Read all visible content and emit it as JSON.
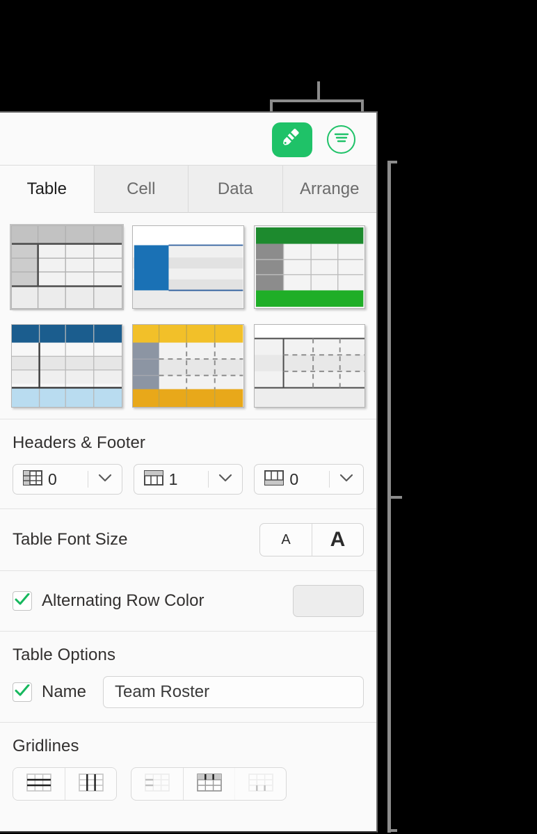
{
  "toolbar": {
    "format_button_label": "Format",
    "format_icon": "paintbrush-icon",
    "menu_button_label": "Format Menu",
    "menu_icon": "list-lines-circle-icon"
  },
  "tabs": [
    {
      "label": "Table",
      "active": true
    },
    {
      "label": "Cell",
      "active": false
    },
    {
      "label": "Data",
      "active": false
    },
    {
      "label": "Arrange",
      "active": false
    }
  ],
  "table_styles": [
    {
      "name": "style-gray-header-column",
      "selected": true
    },
    {
      "name": "style-blue-left-accent",
      "selected": false
    },
    {
      "name": "style-green-header-footer",
      "selected": false
    },
    {
      "name": "style-navy-header-blue-footer",
      "selected": false
    },
    {
      "name": "style-yellow-header-footer",
      "selected": false
    },
    {
      "name": "style-plain-dashed",
      "selected": false
    }
  ],
  "headers_footer": {
    "title": "Headers & Footer",
    "steppers": [
      {
        "icon": "header-columns-icon",
        "value": "0",
        "name": "header-columns-stepper"
      },
      {
        "icon": "header-rows-icon",
        "value": "1",
        "name": "header-rows-stepper"
      },
      {
        "icon": "footer-rows-icon",
        "value": "0",
        "name": "footer-rows-stepper"
      }
    ]
  },
  "font_size": {
    "label": "Table Font Size",
    "decrease_label": "A",
    "increase_label": "A"
  },
  "alternating_row_color": {
    "label": "Alternating Row Color",
    "checked": true,
    "swatch_color": "#ededed"
  },
  "table_options": {
    "title": "Table Options",
    "name_label": "Name",
    "name_checked": true,
    "name_value": "Team Roster"
  },
  "gridlines": {
    "title": "Gridlines",
    "group_one": [
      {
        "name": "gridlines-horizontal-button",
        "icon": "grid-horizontal-icon",
        "state": "on"
      },
      {
        "name": "gridlines-vertical-button",
        "icon": "grid-vertical-icon",
        "state": "on"
      }
    ],
    "group_two": [
      {
        "name": "gridlines-header-horizontal-button",
        "icon": "grid-header-horizontal-icon",
        "state": "dim"
      },
      {
        "name": "gridlines-header-vertical-button",
        "icon": "grid-header-vertical-icon",
        "state": "on"
      },
      {
        "name": "gridlines-footer-vertical-button",
        "icon": "grid-footer-vertical-icon",
        "state": "dim"
      }
    ]
  },
  "colors": {
    "accent_green": "#1fc268",
    "callout_gray": "#8c8c8c",
    "panel_bg": "#fafafa"
  }
}
